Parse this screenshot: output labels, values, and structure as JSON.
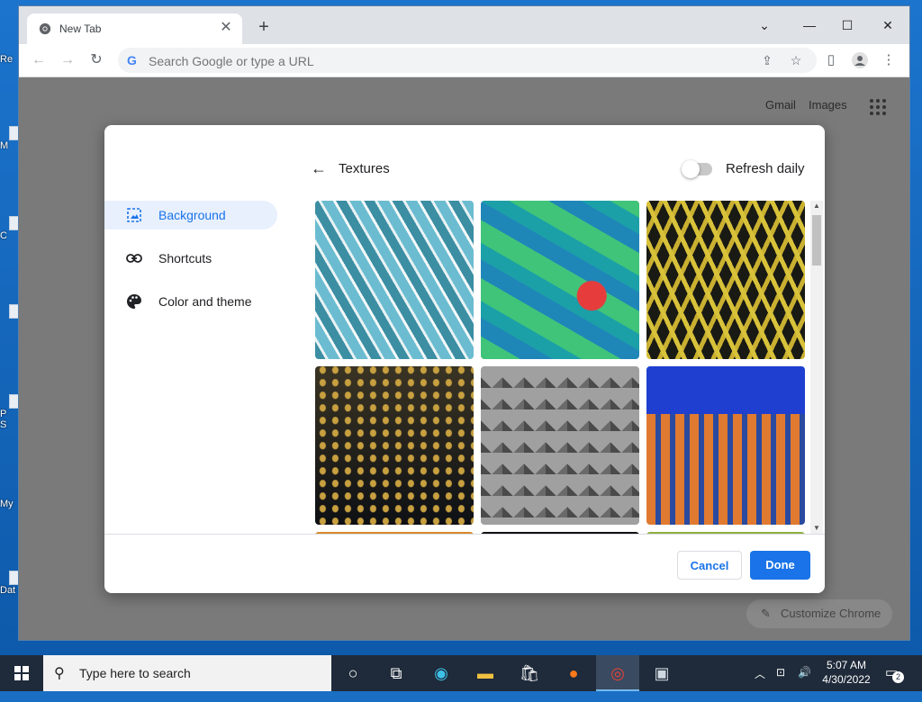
{
  "desktop": {
    "icon_labels": [
      "Re",
      "M",
      "",
      "C",
      "",
      "P",
      "S",
      "My",
      "Dat"
    ]
  },
  "browser": {
    "tab_title": "New Tab",
    "omnibox_placeholder": "Search Google or type a URL",
    "window_controls": [
      "chevron-down-icon",
      "minimize-icon",
      "maximize-icon",
      "close-icon"
    ]
  },
  "newtab": {
    "gmail": "Gmail",
    "images": "Images",
    "customize": "Customize Chrome"
  },
  "dialog": {
    "nav": [
      {
        "label": "Background",
        "icon": "image-icon",
        "active": true
      },
      {
        "label": "Shortcuts",
        "icon": "link-icon",
        "active": false
      },
      {
        "label": "Color and theme",
        "icon": "palette-icon",
        "active": false
      }
    ],
    "section_title": "Textures",
    "refresh_label": "Refresh daily",
    "refresh_on": false,
    "tiles": [
      {
        "name": "texture-glass-lattice",
        "colors": [
          "#4ba3b5",
          "#e6f0f2"
        ]
      },
      {
        "name": "texture-green-blue-waves",
        "colors": [
          "#3fc47a",
          "#1f86b8",
          "#e63c3c"
        ]
      },
      {
        "name": "texture-yellow-lattice",
        "colors": [
          "#d8c23a",
          "#1a1a14"
        ]
      },
      {
        "name": "texture-gold-mesh",
        "colors": [
          "#c8a040",
          "#14161a"
        ]
      },
      {
        "name": "texture-gray-grid",
        "colors": [
          "#9a9a9a",
          "#4a4a4a"
        ]
      },
      {
        "name": "texture-orange-building",
        "colors": [
          "#e07a30",
          "#1e3fd0"
        ]
      },
      {
        "name": "texture-partial-1",
        "colors": [
          "#d98a2a",
          "#3a2a10"
        ]
      },
      {
        "name": "texture-partial-2",
        "colors": [
          "#111111",
          "#444444"
        ]
      },
      {
        "name": "texture-partial-3",
        "colors": [
          "#8fb040",
          "#3a5a20"
        ]
      }
    ],
    "cancel_label": "Cancel",
    "done_label": "Done"
  },
  "taskbar": {
    "search_placeholder": "Type here to search",
    "time": "5:07 AM",
    "date": "4/30/2022",
    "notification_count": "2"
  },
  "colors": {
    "accent": "#1a73e8",
    "active_nav_bg": "#e8f0fe"
  }
}
